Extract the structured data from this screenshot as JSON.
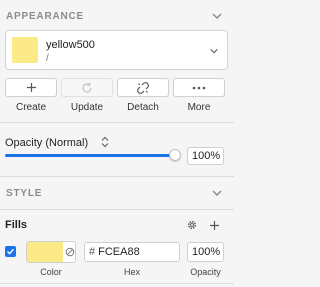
{
  "appearance": {
    "header": "APPEARANCE",
    "style": {
      "name": "yellow500",
      "sub": "/",
      "color": "#FCEA88"
    },
    "actions": [
      {
        "label": "Create",
        "icon": "plus-icon",
        "enabled": true
      },
      {
        "label": "Update",
        "icon": "refresh-icon",
        "enabled": false
      },
      {
        "label": "Detach",
        "icon": "unlink-icon",
        "enabled": true
      },
      {
        "label": "More",
        "icon": "more-icon",
        "enabled": true
      }
    ],
    "opacity": {
      "label": "Opacity (Normal)",
      "value": "100%",
      "level": 1.0
    }
  },
  "style_section": {
    "header": "STYLE"
  },
  "fills": {
    "title": "Fills",
    "enabled": true,
    "color": "#FCEA88",
    "hex_prefix": "#",
    "hex": "FCEA88",
    "opacity": "100%",
    "labels": {
      "color": "Color",
      "hex": "Hex",
      "opacity": "Opacity"
    }
  },
  "colors": {
    "accent": "#1a73e8",
    "swatch": "#FCEA88"
  }
}
